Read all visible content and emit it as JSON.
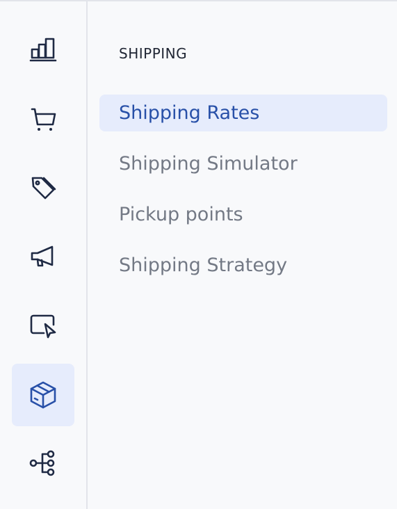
{
  "rail": {
    "items": [
      {
        "icon": "bar-chart-icon",
        "active": false
      },
      {
        "icon": "shopping-cart-icon",
        "active": false
      },
      {
        "icon": "price-tags-icon",
        "active": false
      },
      {
        "icon": "megaphone-icon",
        "active": false
      },
      {
        "icon": "storefront-cursor-icon",
        "active": false
      },
      {
        "icon": "package-box-icon",
        "active": true
      },
      {
        "icon": "workflow-nodes-icon",
        "active": false
      }
    ]
  },
  "menu": {
    "section_title": "SHIPPING",
    "items": [
      {
        "label": "Shipping Rates",
        "active": true
      },
      {
        "label": "Shipping Simulator",
        "active": false
      },
      {
        "label": "Pickup points",
        "active": false
      },
      {
        "label": "Shipping Strategy",
        "active": false
      }
    ]
  },
  "colors": {
    "background": "#f8f9fb",
    "active_background": "#e6ecfc",
    "active_text": "#2850a8",
    "inactive_text": "#737985",
    "icon": "#1f2a44",
    "border": "#e2e4ea"
  }
}
